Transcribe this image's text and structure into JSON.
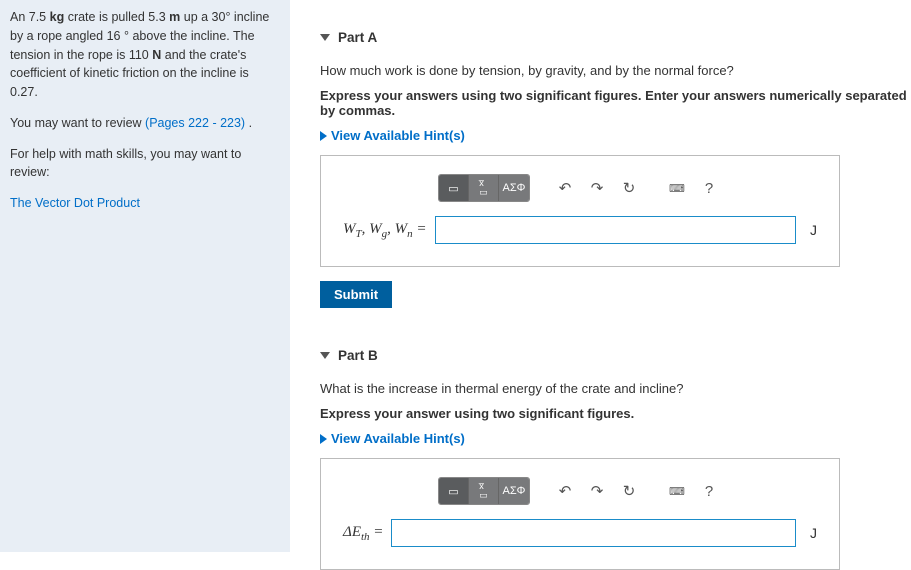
{
  "sidebar": {
    "para1_a": "An 7.5 ",
    "para1_b": " crate is pulled 5.3 ",
    "para1_c": " up a 30",
    "para1_d": " incline by a rope angled 16 ",
    "para1_e": " above the incline. The tension in the rope is 110 ",
    "para1_f": " and the crate's coefficient of kinetic friction on the incline is 0.27.",
    "unit_kg": "kg",
    "unit_m": "m",
    "unit_deg": "°",
    "unit_N": "N",
    "para2_a": "You may want to review ",
    "para2_link": "(Pages 222 - 223)",
    "para2_b": " .",
    "para3": "For help with math skills, you may want to review:",
    "para4_link": "The Vector Dot Product"
  },
  "partA": {
    "title": "Part A",
    "question": "How much work is done by tension, by gravity, and by the normal force?",
    "instruct": "Express your answers using two significant figures. Enter your answers numerically separated by commas.",
    "hints": "View Available Hint(s)",
    "label_html": "W<sub>T</sub>, W<sub>g</sub>, W<sub>n</sub> =",
    "unit": "J",
    "value": ""
  },
  "partB": {
    "title": "Part B",
    "question": "What is the increase in thermal energy of the crate and incline?",
    "instruct": "Express your answer using two significant figures.",
    "hints": "View Available Hint(s)",
    "label_html": "ΔE<sub>th</sub> =",
    "unit": "J",
    "value": ""
  },
  "buttons": {
    "submit": "Submit"
  },
  "toolbar": {
    "greek": "ΑΣΦ",
    "help": "?"
  }
}
